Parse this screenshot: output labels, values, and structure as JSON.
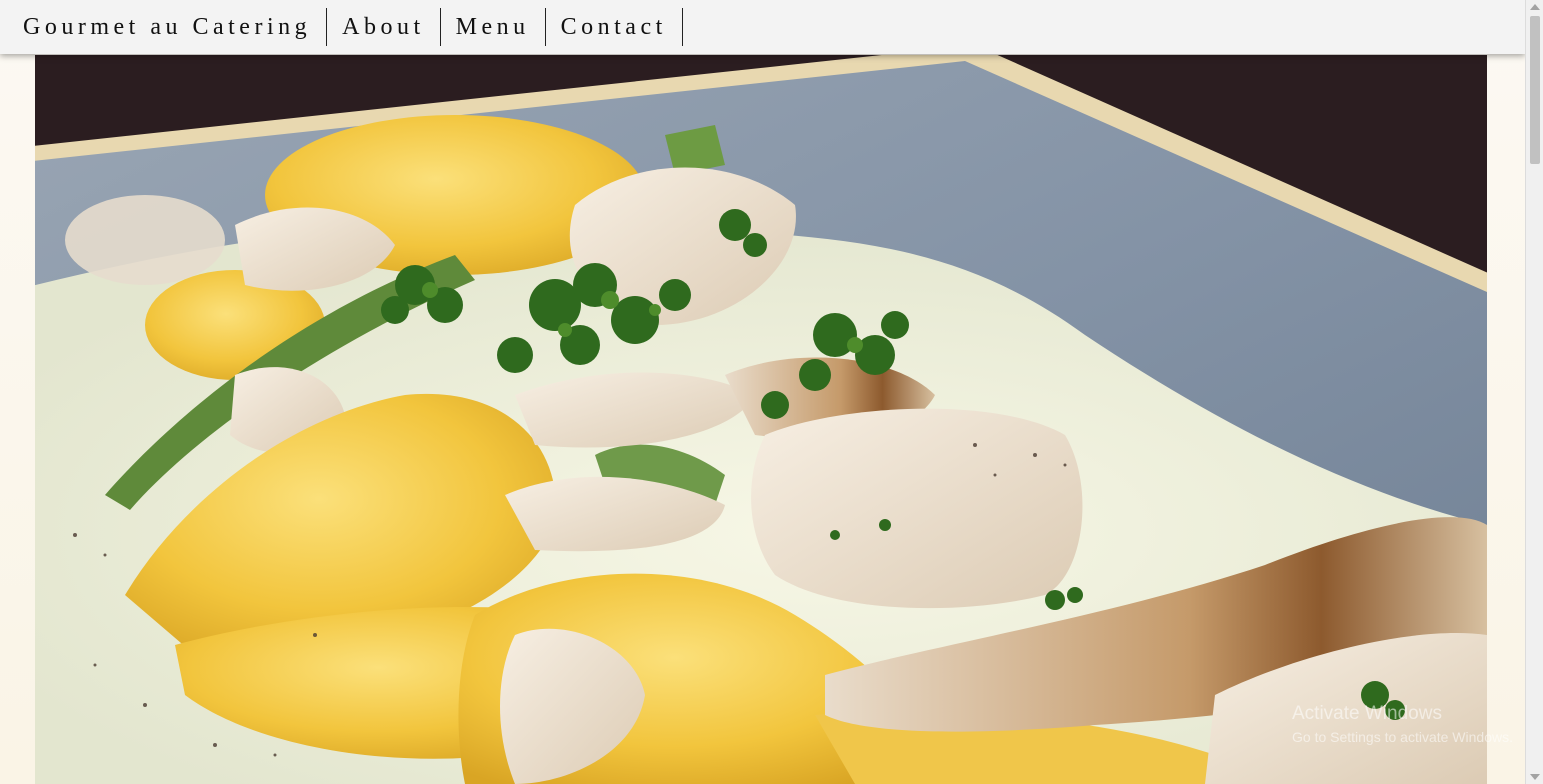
{
  "nav": {
    "brand": "Gourmet au Catering",
    "items": [
      "About",
      "Menu",
      "Contact"
    ]
  },
  "hero": {
    "image": "ravioli-chicken-cream-sauce-plate"
  },
  "watermark": {
    "title": "Activate Windows",
    "subtitle": "Go to Settings to activate Windows."
  },
  "colors": {
    "nav_bg": "#f3f3f3",
    "page_bg": "#fbf6ea",
    "plate": "#8a99ab",
    "sauce": "#eef0dc",
    "pasta": "#f2c53d",
    "chicken": "#ece2d2",
    "parsley": "#2f6a1e",
    "asparagus": "#5f8a3a"
  }
}
